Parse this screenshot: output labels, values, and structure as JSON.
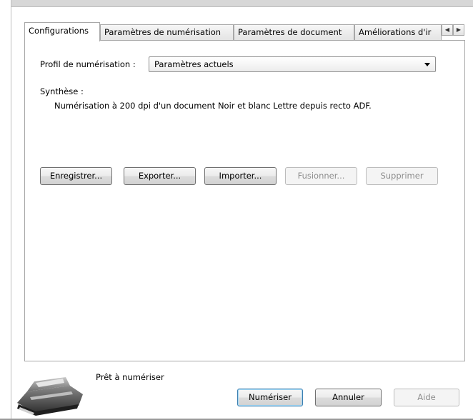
{
  "tabs": [
    {
      "label": "Configurations",
      "active": true
    },
    {
      "label": "Paramètres de numérisation",
      "active": false
    },
    {
      "label": "Paramètres de document",
      "active": false
    },
    {
      "label": "Améliorations d'ir",
      "active": false
    }
  ],
  "profile": {
    "label": "Profil de numérisation :",
    "selected": "Paramètres actuels"
  },
  "summary": {
    "label": "Synthèse :",
    "text": "Numérisation à 200 dpi d'un document Noir et blanc Lettre depuis recto ADF."
  },
  "actions": {
    "save": "Enregistrer...",
    "export": "Exporter...",
    "import": "Importer...",
    "merge": "Fusionner...",
    "delete": "Supprimer"
  },
  "status": "Prêt à numériser",
  "footer": {
    "scan": "Numériser",
    "cancel": "Annuler",
    "help": "Aide"
  },
  "icons": {
    "tab_left": "scroll-left-icon",
    "tab_right": "scroll-right-icon",
    "scanner": "scanner-icon"
  }
}
